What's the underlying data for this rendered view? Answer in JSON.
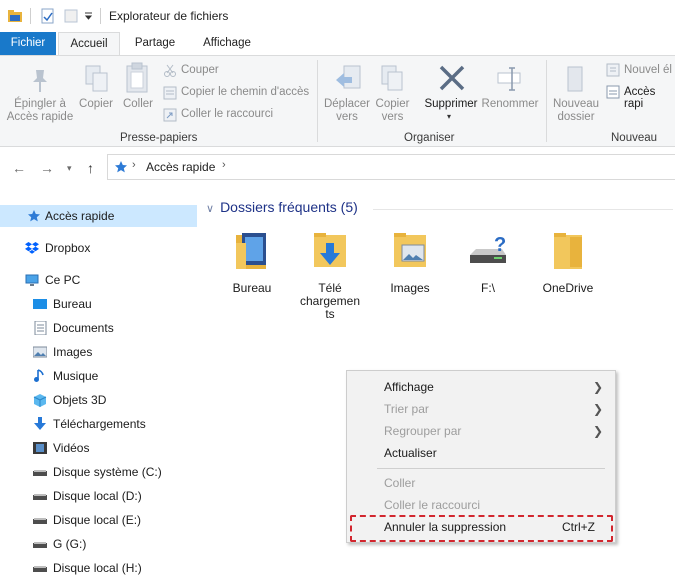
{
  "window": {
    "title": "Explorateur de fichiers"
  },
  "ribbon_tabs": [
    "Fichier",
    "Accueil",
    "Partage",
    "Affichage"
  ],
  "ribbon": {
    "presse_papiers": {
      "pin": "Épingler à\nAccès rapide",
      "pin_l1": "Épingler à",
      "pin_l2": "Accès rapide",
      "copy": "Copier",
      "paste": "Coller",
      "cut": "Couper",
      "copy_path": "Copier le chemin d'accès",
      "paste_shortcut": "Coller le raccourci",
      "label": "Presse-papiers"
    },
    "organiser": {
      "move_l1": "Déplacer",
      "move_l2": "vers",
      "copyto_l1": "Copier",
      "copyto_l2": "vers",
      "delete": "Supprimer",
      "rename": "Renommer",
      "label": "Organiser"
    },
    "nouveau": {
      "new_folder_l1": "Nouveau",
      "new_folder_l2": "dossier",
      "new_item": "Nouvel él",
      "easy_access": "Accès rapi",
      "label": "Nouveau"
    }
  },
  "address": {
    "path": "Accès rapide"
  },
  "sidebar": [
    {
      "label": "Accès rapide",
      "icon": "star-icon"
    },
    {
      "label": "Dropbox",
      "icon": "dropbox-icon"
    },
    {
      "label": "Ce PC",
      "icon": "pc-icon"
    },
    {
      "label": "Bureau",
      "icon": "desktop-icon"
    },
    {
      "label": "Documents",
      "icon": "documents-icon"
    },
    {
      "label": "Images",
      "icon": "images-icon"
    },
    {
      "label": "Musique",
      "icon": "music-icon"
    },
    {
      "label": "Objets 3D",
      "icon": "objects3d-icon"
    },
    {
      "label": "Téléchargements",
      "icon": "download-icon"
    },
    {
      "label": "Vidéos",
      "icon": "video-icon"
    },
    {
      "label": "Disque système (C:)",
      "icon": "drive-icon"
    },
    {
      "label": "Disque local (D:)",
      "icon": "drive-icon"
    },
    {
      "label": "Disque local (E:)",
      "icon": "drive-icon"
    },
    {
      "label": "G (G:)",
      "icon": "drive-icon"
    },
    {
      "label": "Disque local (H:)",
      "icon": "drive-icon"
    }
  ],
  "content": {
    "section_title": "Dossiers fréquents (5)",
    "folders": [
      {
        "label": "Bureau"
      },
      {
        "label_l1": "Télé",
        "label_l2": "chargemen",
        "label_l3": "ts"
      },
      {
        "label": "Images"
      },
      {
        "label": "F:\\"
      },
      {
        "label": "OneDrive"
      }
    ]
  },
  "context_menu": {
    "items": [
      {
        "label": "Affichage",
        "enabled": true,
        "submenu": true
      },
      {
        "label": "Trier par",
        "enabled": false,
        "submenu": true
      },
      {
        "label": "Regrouper par",
        "enabled": false,
        "submenu": true
      },
      {
        "label": "Actualiser",
        "enabled": true
      },
      {
        "label": "Coller",
        "enabled": false
      },
      {
        "label": "Coller le raccourci",
        "enabled": false
      },
      {
        "label": "Annuler la suppression",
        "shortcut": "Ctrl+Z",
        "enabled": true
      }
    ]
  },
  "colors": {
    "accent": "#1979ca",
    "selection": "#cce8ff",
    "highlight": "#d2262e"
  }
}
